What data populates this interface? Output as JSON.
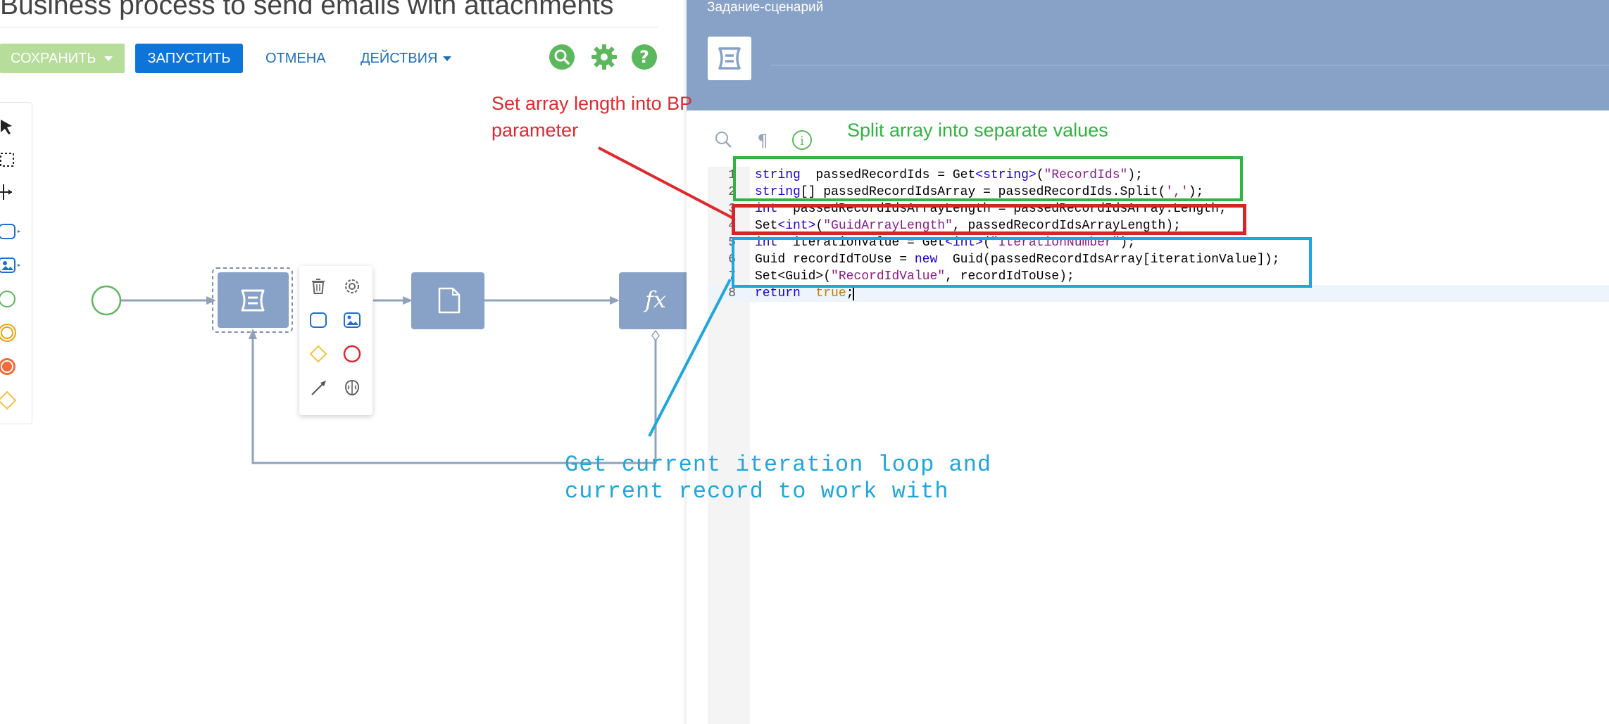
{
  "page": {
    "title": "Business process to send emails with attachments"
  },
  "toolbar": {
    "save_label": "СОХРАНИТЬ",
    "run_label": "ЗАПУСТИТЬ",
    "cancel_label": "ОТМЕНА",
    "actions_label": "ДЕЙСТВИЯ",
    "icons": [
      "search-icon",
      "gear-icon",
      "help-icon"
    ],
    "icon_color": "#5cb85c"
  },
  "toolbox": {
    "items": [
      "pointer-tool",
      "lasso-select-tool",
      "space-tool",
      "task-tool",
      "subprocess-tool",
      "start-event-tool",
      "intermediate-event-tool",
      "end-event-tool",
      "gateway-tool"
    ]
  },
  "diagram": {
    "elements": [
      "start-event",
      "script-task",
      "document-task",
      "formula-task"
    ],
    "popup_items": [
      "delete-icon",
      "settings-icon",
      "task-icon",
      "image-task-icon",
      "gateway-icon",
      "end-event-icon",
      "connector-icon",
      "ai-brain-icon"
    ]
  },
  "editor": {
    "title": "Задание-сценарий",
    "header_color": "#87a1c7",
    "tools": [
      "search-icon",
      "paragraph-icon",
      "info-icon"
    ],
    "lines": [
      {
        "n": "1",
        "parts": [
          [
            "kw",
            "string"
          ],
          [
            "",
            "  passedRecordIds = Get"
          ],
          [
            "kw",
            "<string>"
          ],
          [
            "",
            "("
          ],
          [
            "str",
            "\"RecordIds\""
          ],
          [
            "",
            ");"
          ]
        ]
      },
      {
        "n": "2",
        "parts": [
          [
            "kw",
            "string"
          ],
          [
            "",
            "[] passedRecordIdsArray = passedRecordIds.Split("
          ],
          [
            "str",
            "','"
          ],
          [
            "",
            ");"
          ]
        ]
      },
      {
        "n": "3",
        "parts": [
          [
            "kw",
            "int"
          ],
          [
            "",
            "  passedRecordIdsArrayLength = passedRecordIdsArray.Length;"
          ]
        ]
      },
      {
        "n": "4",
        "parts": [
          [
            "",
            "Set"
          ],
          [
            "kw",
            "<int>"
          ],
          [
            "",
            "("
          ],
          [
            "str",
            "\"GuidArrayLength\""
          ],
          [
            "",
            ", passedRecordIdsArrayLength);"
          ]
        ]
      },
      {
        "n": "5",
        "parts": [
          [
            "kw",
            "int"
          ],
          [
            "",
            "  iterationValue = Get"
          ],
          [
            "kw",
            "<int>"
          ],
          [
            "",
            "("
          ],
          [
            "str",
            "\"IterationNumber\""
          ],
          [
            "",
            ");"
          ]
        ]
      },
      {
        "n": "6",
        "parts": [
          [
            "",
            "Guid recordIdToUse = "
          ],
          [
            "kw",
            "new"
          ],
          [
            "",
            "  Guid(passedRecordIdsArray[iterationValue]);"
          ]
        ]
      },
      {
        "n": "7",
        "parts": [
          [
            "",
            "Set<Guid>("
          ],
          [
            "str",
            "\"RecordIdValue\""
          ],
          [
            "",
            ", recordIdToUse);"
          ]
        ]
      },
      {
        "n": "8",
        "parts": [
          [
            "kw",
            "return"
          ],
          [
            "",
            "  "
          ],
          [
            "kw2",
            "true"
          ],
          [
            "",
            ";"
          ]
        ]
      }
    ]
  },
  "annotations": {
    "red_text": [
      "Set array length into BP",
      "parameter"
    ],
    "green_text": "Split array into separate values",
    "blue_text": [
      "Get current iteration loop and",
      "current record to work with"
    ],
    "red_color": "#e0292e",
    "green_color": "#2fb43f",
    "blue_color": "#1ea6de"
  }
}
